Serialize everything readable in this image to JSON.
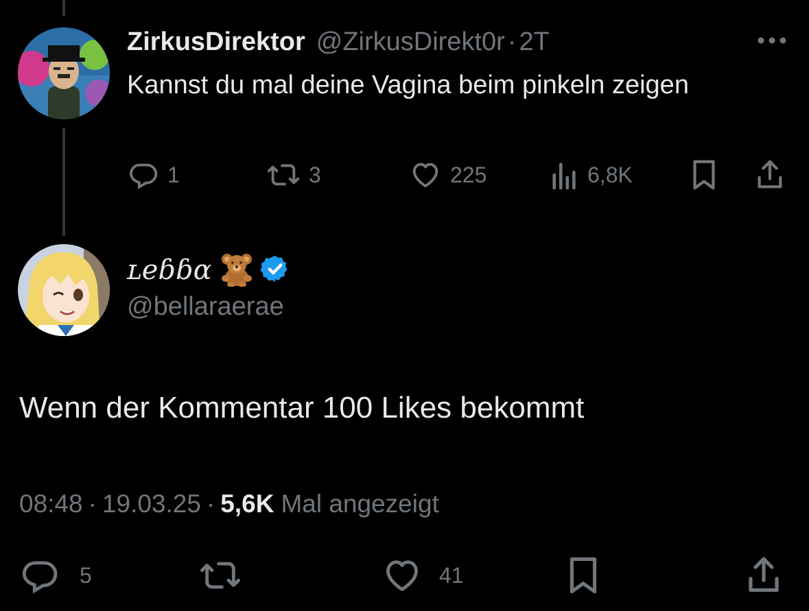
{
  "parent_tweet": {
    "display_name": "ZirkusDirektor",
    "handle": "@ZirkusDirekt0r",
    "separator": "·",
    "time_ago": "2T",
    "text": "Kannst du mal deine Vagina beim pinkeln zeigen",
    "actions": {
      "replies": "1",
      "reposts": "3",
      "likes": "225",
      "views": "6,8K"
    }
  },
  "reply_tweet": {
    "display_name": "ʟeɓɓɑ",
    "emoji_icon": "teddy-bear-icon",
    "verified": true,
    "handle": "@bellaraerae",
    "text": "Wenn der Kommentar 100 Likes bekommt",
    "meta": {
      "time": "08:48",
      "separator": "·",
      "date": "19.03.25",
      "views_count": "5,6K",
      "views_label": "Mal angezeigt"
    },
    "actions": {
      "replies": "5",
      "likes": "41"
    }
  },
  "colors": {
    "background": "#000000",
    "text_primary": "#e7e9ea",
    "text_secondary": "#71767b",
    "verified_blue": "#1d9bf0",
    "thread_line": "#333639"
  }
}
